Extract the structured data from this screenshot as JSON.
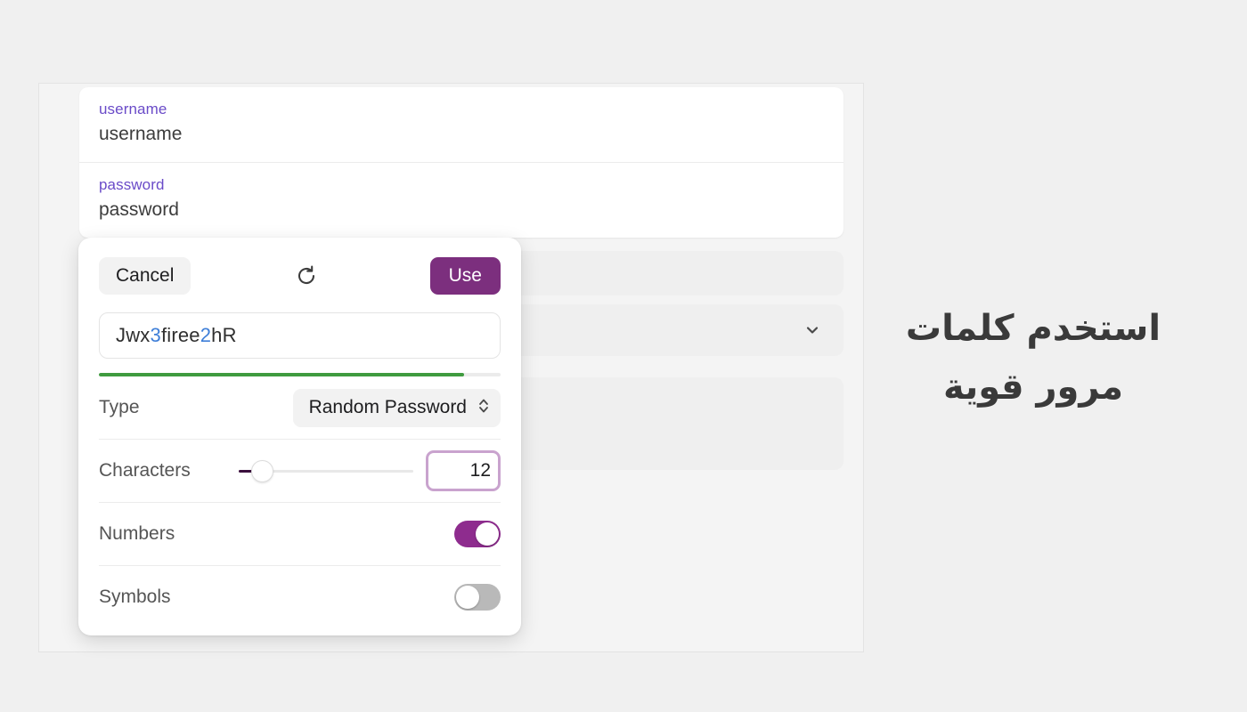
{
  "credentials": {
    "fields": [
      {
        "label": "username",
        "value": "username"
      },
      {
        "label": "password",
        "value": "password"
      }
    ]
  },
  "background_rows": [
    {
      "name": "row-plain-top",
      "chevron": ""
    },
    {
      "name": "row-with-chevron",
      "chevron": "chevron-down-icon"
    },
    {
      "name": "row-plain-bottom",
      "chevron": ""
    }
  ],
  "generator": {
    "cancel_label": "Cancel",
    "refresh_icon": "refresh-icon",
    "use_label": "Use",
    "password": {
      "full": "Jwx3firee2hR",
      "segments": [
        {
          "text": "Jwx",
          "kind": "letter"
        },
        {
          "text": "3",
          "kind": "digit"
        },
        {
          "text": "firee",
          "kind": "letter"
        },
        {
          "text": "2",
          "kind": "digit"
        },
        {
          "text": "hR",
          "kind": "letter"
        }
      ]
    },
    "strength": {
      "percent": 91,
      "color": "#3f9b3f"
    },
    "options": {
      "type": {
        "label": "Type",
        "value": "Random Password",
        "stepper_icon": "chevron-up-down-icon"
      },
      "characters": {
        "label": "Characters",
        "value": "12",
        "slider_percent": 8
      },
      "numbers": {
        "label": "Numbers",
        "state": "on"
      },
      "symbols": {
        "label": "Symbols",
        "state": "off"
      }
    }
  },
  "caption": {
    "line1": "استخدم كلمات",
    "line2": "مرور قوية"
  },
  "colors": {
    "accent_purple": "#7c2f7e",
    "toggle_on": "#8e2c8e",
    "label_purple": "#6a4bc8",
    "digit_blue": "#3f7fd8",
    "strength_green": "#3f9b3f",
    "focus_border": "#c9a3ce"
  }
}
